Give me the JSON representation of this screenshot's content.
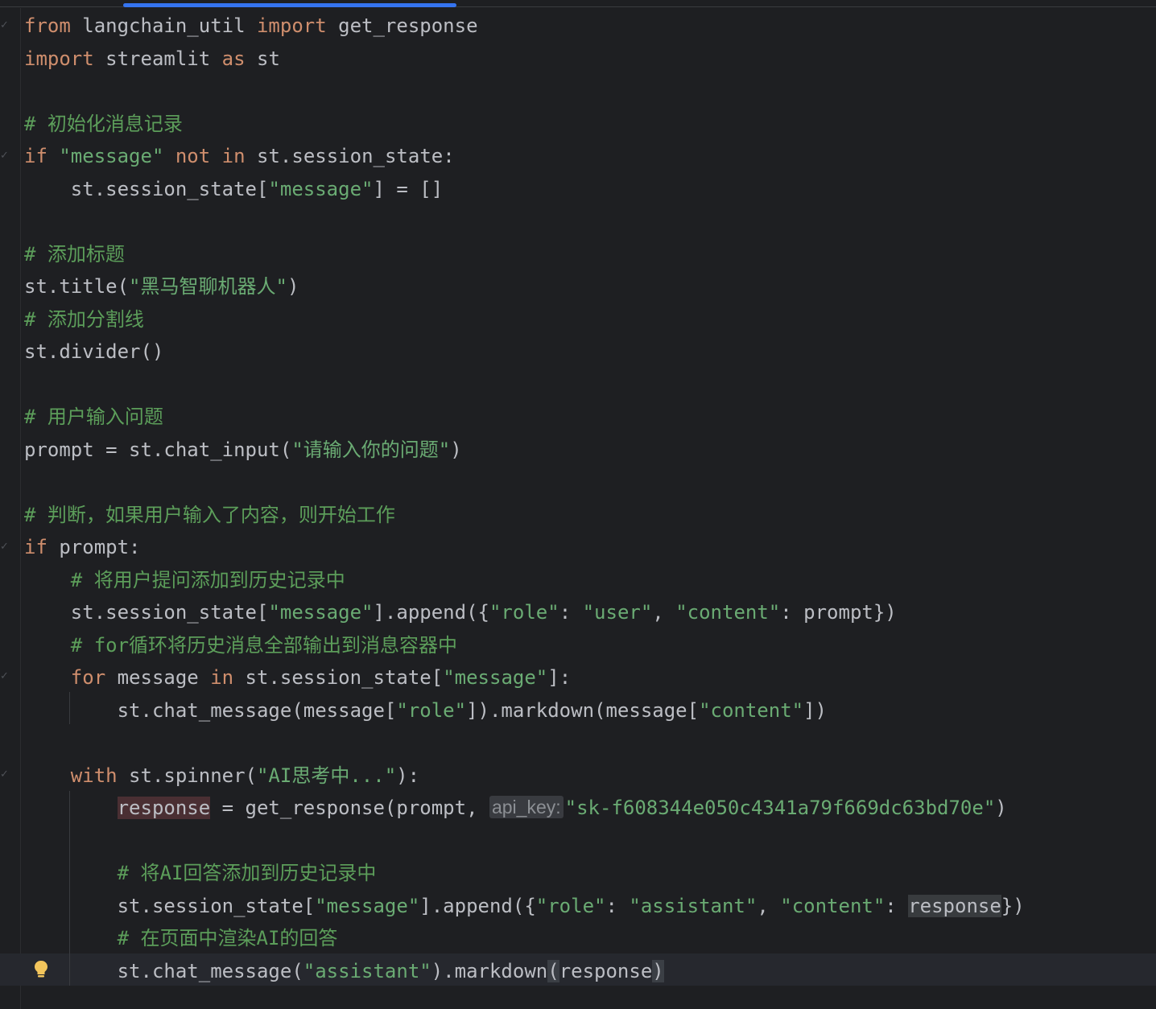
{
  "editor": {
    "lines": [
      {
        "segments": [
          {
            "t": "from",
            "c": "kw"
          },
          {
            "t": " langchain_util ",
            "c": ""
          },
          {
            "t": "import",
            "c": "kw"
          },
          {
            "t": " get_response",
            "c": ""
          }
        ]
      },
      {
        "segments": [
          {
            "t": "import",
            "c": "kw"
          },
          {
            "t": " streamlit ",
            "c": ""
          },
          {
            "t": "as",
            "c": "kw"
          },
          {
            "t": " st",
            "c": ""
          }
        ]
      },
      {
        "segments": []
      },
      {
        "segments": [
          {
            "t": "# 初始化消息记录",
            "c": "cmt"
          }
        ]
      },
      {
        "segments": [
          {
            "t": "if",
            "c": "kw"
          },
          {
            "t": " ",
            "c": ""
          },
          {
            "t": "\"message\"",
            "c": "str"
          },
          {
            "t": " ",
            "c": ""
          },
          {
            "t": "not",
            "c": "kw"
          },
          {
            "t": " ",
            "c": ""
          },
          {
            "t": "in",
            "c": "kw"
          },
          {
            "t": " st.session_state:",
            "c": ""
          }
        ]
      },
      {
        "segments": [
          {
            "t": "    st.session_state[",
            "c": ""
          },
          {
            "t": "\"message\"",
            "c": "str"
          },
          {
            "t": "] = []",
            "c": ""
          }
        ]
      },
      {
        "segments": []
      },
      {
        "segments": [
          {
            "t": "# 添加标题",
            "c": "cmt"
          }
        ]
      },
      {
        "segments": [
          {
            "t": "st.title(",
            "c": ""
          },
          {
            "t": "\"黑马智聊机器人\"",
            "c": "str"
          },
          {
            "t": ")",
            "c": ""
          }
        ]
      },
      {
        "segments": [
          {
            "t": "# 添加分割线",
            "c": "cmt"
          }
        ]
      },
      {
        "segments": [
          {
            "t": "st.divider()",
            "c": ""
          }
        ]
      },
      {
        "segments": []
      },
      {
        "segments": [
          {
            "t": "# 用户输入问题",
            "c": "cmt"
          }
        ]
      },
      {
        "segments": [
          {
            "t": "prompt = st.chat_input(",
            "c": ""
          },
          {
            "t": "\"请输入你的问题\"",
            "c": "str"
          },
          {
            "t": ")",
            "c": ""
          }
        ]
      },
      {
        "segments": []
      },
      {
        "segments": [
          {
            "t": "# 判断，如果用户输入了内容，则开始工作",
            "c": "cmt"
          }
        ]
      },
      {
        "segments": [
          {
            "t": "if",
            "c": "kw"
          },
          {
            "t": " prompt:",
            "c": ""
          }
        ]
      },
      {
        "segments": [
          {
            "t": "    ",
            "c": ""
          },
          {
            "t": "# 将用户提问添加到历史记录中",
            "c": "cmt"
          }
        ]
      },
      {
        "segments": [
          {
            "t": "    st.session_state[",
            "c": ""
          },
          {
            "t": "\"message\"",
            "c": "str"
          },
          {
            "t": "].append({",
            "c": ""
          },
          {
            "t": "\"role\"",
            "c": "str"
          },
          {
            "t": ": ",
            "c": ""
          },
          {
            "t": "\"user\"",
            "c": "str"
          },
          {
            "t": ", ",
            "c": ""
          },
          {
            "t": "\"content\"",
            "c": "str"
          },
          {
            "t": ": prompt})",
            "c": ""
          }
        ]
      },
      {
        "segments": [
          {
            "t": "    ",
            "c": ""
          },
          {
            "t": "# for循环将历史消息全部输出到消息容器中",
            "c": "cmt"
          }
        ]
      },
      {
        "segments": [
          {
            "t": "    ",
            "c": ""
          },
          {
            "t": "for",
            "c": "kw"
          },
          {
            "t": " message ",
            "c": ""
          },
          {
            "t": "in",
            "c": "kw"
          },
          {
            "t": " st.session_state[",
            "c": ""
          },
          {
            "t": "\"message\"",
            "c": "str"
          },
          {
            "t": "]:",
            "c": ""
          }
        ]
      },
      {
        "segments": [
          {
            "t": "        st.chat_message(message[",
            "c": ""
          },
          {
            "t": "\"role\"",
            "c": "str"
          },
          {
            "t": "]).markdown(message[",
            "c": ""
          },
          {
            "t": "\"content\"",
            "c": "str"
          },
          {
            "t": "])",
            "c": ""
          }
        ]
      },
      {
        "segments": []
      },
      {
        "segments": [
          {
            "t": "    ",
            "c": ""
          },
          {
            "t": "with",
            "c": "kw"
          },
          {
            "t": " st.spinner(",
            "c": ""
          },
          {
            "t": "\"AI思考中...\"",
            "c": "str"
          },
          {
            "t": "):",
            "c": ""
          }
        ]
      },
      {
        "segments": [
          {
            "t": "        ",
            "c": ""
          },
          {
            "t": "response",
            "c": "hl-write"
          },
          {
            "t": " = get_response(prompt, ",
            "c": ""
          },
          {
            "t": "api_key:",
            "c": "hint"
          },
          {
            "t": "\"sk-f608344e050c4341a79f669dc63bd70e\"",
            "c": "str"
          },
          {
            "t": ")",
            "c": ""
          }
        ]
      },
      {
        "segments": []
      },
      {
        "segments": [
          {
            "t": "        ",
            "c": ""
          },
          {
            "t": "# 将AI回答添加到历史记录中",
            "c": "cmt"
          }
        ]
      },
      {
        "segments": [
          {
            "t": "        st.session_state[",
            "c": ""
          },
          {
            "t": "\"message\"",
            "c": "str"
          },
          {
            "t": "].append({",
            "c": ""
          },
          {
            "t": "\"role\"",
            "c": "str"
          },
          {
            "t": ": ",
            "c": ""
          },
          {
            "t": "\"assistant\"",
            "c": "str"
          },
          {
            "t": ", ",
            "c": ""
          },
          {
            "t": "\"content\"",
            "c": "str"
          },
          {
            "t": ": ",
            "c": ""
          },
          {
            "t": "response",
            "c": "hl-read"
          },
          {
            "t": "})",
            "c": ""
          }
        ]
      },
      {
        "segments": [
          {
            "t": "        ",
            "c": ""
          },
          {
            "t": "# 在页面中渲染AI的回答",
            "c": "cmt"
          }
        ]
      },
      {
        "segments": [
          {
            "t": "        st.chat_message(",
            "c": ""
          },
          {
            "t": "\"assistant\"",
            "c": "str"
          },
          {
            "t": ").markdown",
            "c": ""
          },
          {
            "t": "(",
            "c": "brace-match"
          },
          {
            "t": "response",
            "c": ""
          },
          {
            "t": ")",
            "c": "brace-match"
          }
        ]
      }
    ]
  },
  "colors": {
    "background": "#1e1f22",
    "keyword": "#cf8e6d",
    "string": "#6aab73",
    "comment": "#5c9e5a",
    "text": "#bcbec4"
  },
  "icons": {
    "fold_marker": "fold-icon",
    "intention": "lightbulb-icon"
  }
}
